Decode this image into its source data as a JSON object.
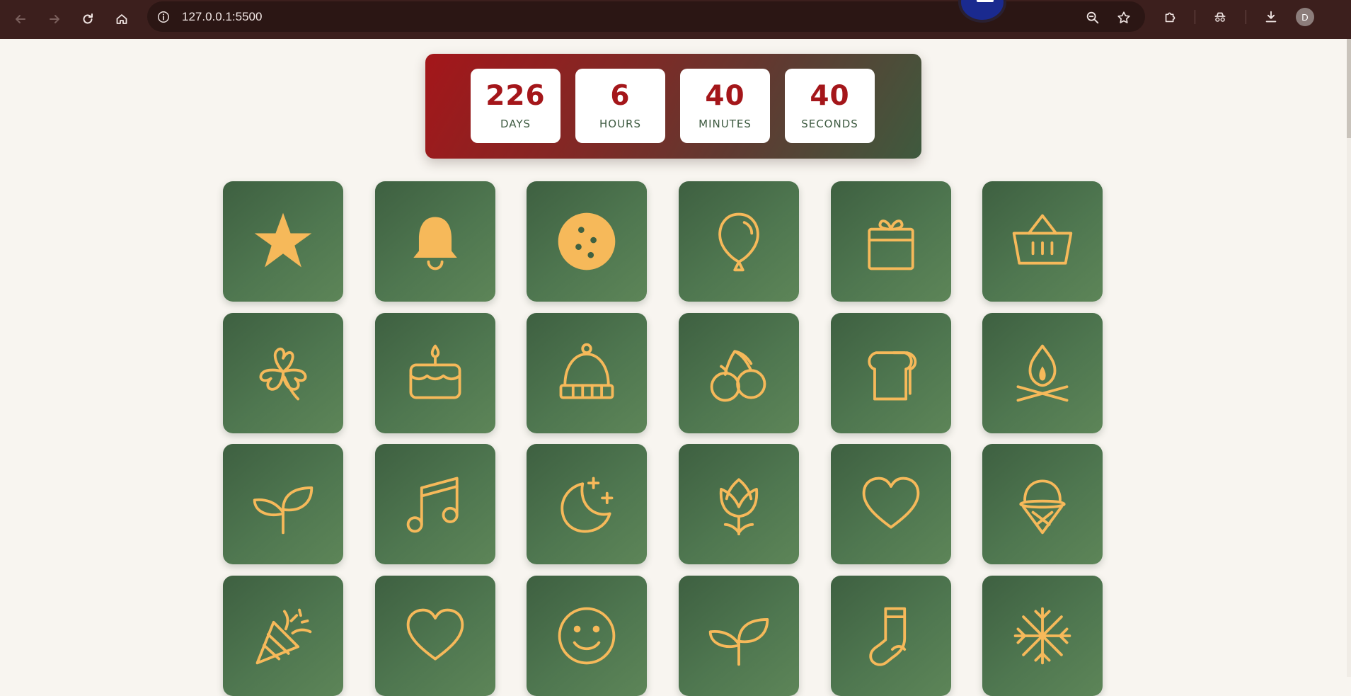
{
  "browser": {
    "url": "127.0.0.1:5500",
    "profile_initial": "D",
    "icons": [
      "back-icon",
      "forward-icon",
      "reload-icon",
      "home-icon",
      "site-info-icon",
      "zoom-icon",
      "bookmark-star-icon",
      "extensions-icon",
      "incognito-icon",
      "downloads-icon"
    ]
  },
  "countdown": {
    "days": {
      "value": "226",
      "label": "DAYS"
    },
    "hours": {
      "value": "6",
      "label": "HOURS"
    },
    "minutes": {
      "value": "40",
      "label": "MINUTES"
    },
    "seconds": {
      "value": "40",
      "label": "SECONDS"
    }
  },
  "colors": {
    "accent_red": "#a4161a",
    "tile_green": "#4a7048",
    "icon_gold": "#f6b95a",
    "page_bg": "#f8f5f0"
  },
  "tiles": [
    {
      "icon": "star-icon"
    },
    {
      "icon": "bell-icon"
    },
    {
      "icon": "cookie-icon"
    },
    {
      "icon": "balloon-icon"
    },
    {
      "icon": "gift-icon"
    },
    {
      "icon": "basket-icon"
    },
    {
      "icon": "clover-icon"
    },
    {
      "icon": "cake-icon"
    },
    {
      "icon": "beanie-icon"
    },
    {
      "icon": "cherries-icon"
    },
    {
      "icon": "bread-icon"
    },
    {
      "icon": "campfire-icon"
    },
    {
      "icon": "sprout-icon"
    },
    {
      "icon": "music-notes-icon"
    },
    {
      "icon": "moon-stars-icon"
    },
    {
      "icon": "tulip-icon"
    },
    {
      "icon": "heart-icon"
    },
    {
      "icon": "ice-cream-icon"
    },
    {
      "icon": "party-popper-icon"
    },
    {
      "icon": "heart-icon"
    },
    {
      "icon": "smiley-icon"
    },
    {
      "icon": "sprout-icon"
    },
    {
      "icon": "sock-icon"
    },
    {
      "icon": "snowflake-icon"
    }
  ]
}
